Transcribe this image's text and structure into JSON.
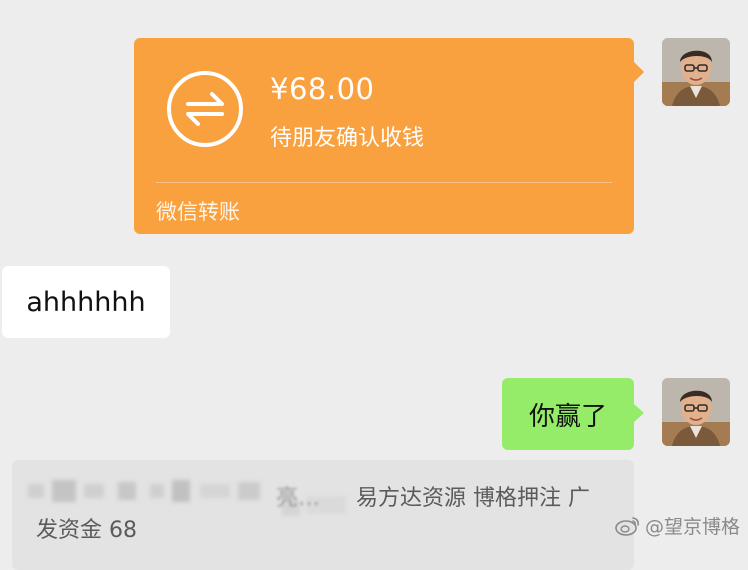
{
  "transfer": {
    "amount": "¥68.00",
    "status": "待朋友确认收钱",
    "footer": "微信转账",
    "icon": "transfer-arrows-icon",
    "bg_color": "#f9a03f"
  },
  "messages": {
    "received_text": "ahhhhhh",
    "sent_text": "你赢了",
    "sent_bubble_color": "#95ec69"
  },
  "bottom_message": {
    "obscured_prefix": "亮…",
    "line1": "易方达资源 博格押注 广",
    "line2": "发资金 68"
  },
  "watermark": {
    "icon": "weibo-icon",
    "text": "@望京博格"
  }
}
